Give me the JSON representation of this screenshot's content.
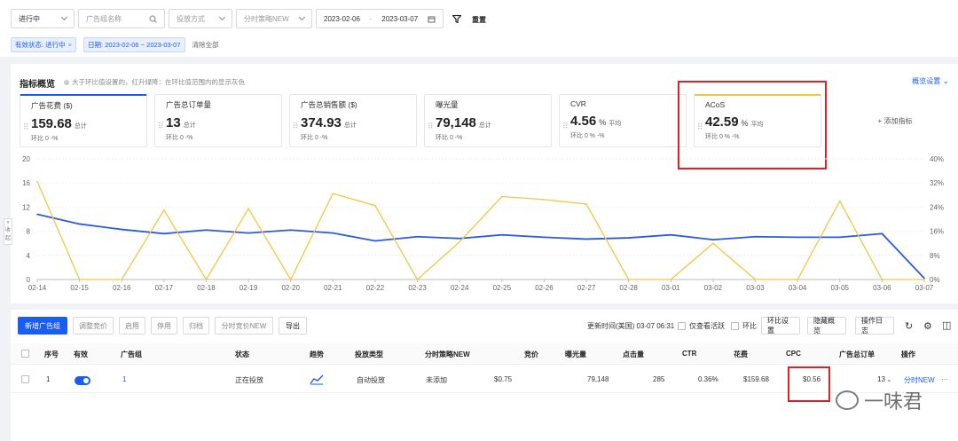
{
  "filters": {
    "status_select": "进行中",
    "adgroup_placeholder": "广告组名称",
    "delivery_select": "投放方式",
    "schedule_select": "分时策略NEW",
    "date_from": "2023-02-06",
    "date_sep": "-",
    "date_to": "2023-03-07",
    "reset_label": "重置"
  },
  "active_tags": [
    {
      "label": "有效状态: 进行中"
    },
    {
      "label": "日期: 2023-02-06 ~ 2023-03-07"
    }
  ],
  "clear_all": "清除全部",
  "metrics": {
    "title": "指标概览",
    "hint": "大于环比值设置的，红升绿降：在环比值范围内的显示灰色",
    "settings": "概览设置",
    "add_metric": "+ 添加指标",
    "kpis": [
      {
        "name": "广告花费 ($)",
        "value": "159.68",
        "unit": "",
        "suffix": "总计",
        "compare": "环比  0   -%"
      },
      {
        "name": "广告总订单量",
        "value": "13",
        "unit": "",
        "suffix": "总计",
        "compare": "环比  0   -%"
      },
      {
        "name": "广告总销售额 ($)",
        "value": "374.93",
        "unit": "",
        "suffix": "总计",
        "compare": "环比  0   -%"
      },
      {
        "name": "曝光量",
        "value": "79,148",
        "unit": "",
        "suffix": "总计",
        "compare": "环比  0   -%"
      },
      {
        "name": "CVR",
        "value": "4.56",
        "unit": "%",
        "suffix": "平均",
        "compare": "环比  0 %   -%"
      },
      {
        "name": "ACoS",
        "value": "42.59",
        "unit": "%",
        "suffix": "平均",
        "compare": "环比  0 %   -%"
      }
    ]
  },
  "chart_data": {
    "type": "line",
    "x": [
      "02-14",
      "02-15",
      "02-16",
      "02-17",
      "02-18",
      "02-19",
      "02-20",
      "02-21",
      "02-22",
      "02-23",
      "02-24",
      "02-25",
      "02-26",
      "02-27",
      "02-28",
      "03-01",
      "03-02",
      "03-03",
      "03-04",
      "03-05",
      "03-06",
      "03-07"
    ],
    "y_left_ticks": [
      "0",
      "4",
      "8",
      "12",
      "16",
      "20"
    ],
    "y_right_ticks": [
      "0%",
      "8%",
      "16%",
      "24%",
      "32%",
      "40%"
    ],
    "ylim_left": [
      0,
      20
    ],
    "ylim_right": [
      0,
      40
    ],
    "series": [
      {
        "axis": "left",
        "color": "#2b5be0",
        "values": [
          10.8,
          9.2,
          8.3,
          7.6,
          8.2,
          7.7,
          8.2,
          7.7,
          6.4,
          7.1,
          6.8,
          7.4,
          7.0,
          6.7,
          6.9,
          7.4,
          6.6,
          7.1,
          7.0,
          7.0,
          7.6,
          0.2
        ]
      },
      {
        "axis": "right",
        "color": "#f5c542",
        "values": [
          32.5,
          0,
          0,
          23.0,
          0,
          23.5,
          0,
          28.5,
          24.5,
          0,
          12.5,
          27.5,
          26.5,
          25.0,
          0,
          0,
          12.0,
          0,
          0,
          26.0,
          0,
          0
        ]
      }
    ],
    "grid": true
  },
  "table": {
    "buttons": [
      "新增广告组",
      "调整竞价",
      "启用",
      "停用",
      "归档",
      "分时竞价NEW",
      "导出"
    ],
    "update_time": "更新时间(美国) 03-07 06:31",
    "only_active": "仅查看活跃",
    "mom": "环比",
    "mom_settings": "环比设置",
    "hide_overview": "隐藏概览",
    "operation_log": "操作日志",
    "headers": [
      "序号",
      "有效",
      "广告组",
      "状态",
      "趋势",
      "投放类型",
      "分时策略NEW",
      "竞价",
      "曝光量",
      "点击量",
      "CTR",
      "花费",
      "CPC",
      "广告总订单",
      "操作"
    ],
    "row": {
      "index": "1",
      "adgroup": "1",
      "status": "正在投放",
      "delivery_type": "自动投放",
      "schedule": "未添加",
      "bid": "$0.75",
      "impressions": "79,148",
      "clicks": "285",
      "ctr": "0.36%",
      "spend": "$159.68",
      "cpc": "$0.56",
      "orders": "13",
      "action": "分时NEW",
      "more": "···"
    }
  },
  "collapse_label": "收起",
  "watermark": "一味君"
}
